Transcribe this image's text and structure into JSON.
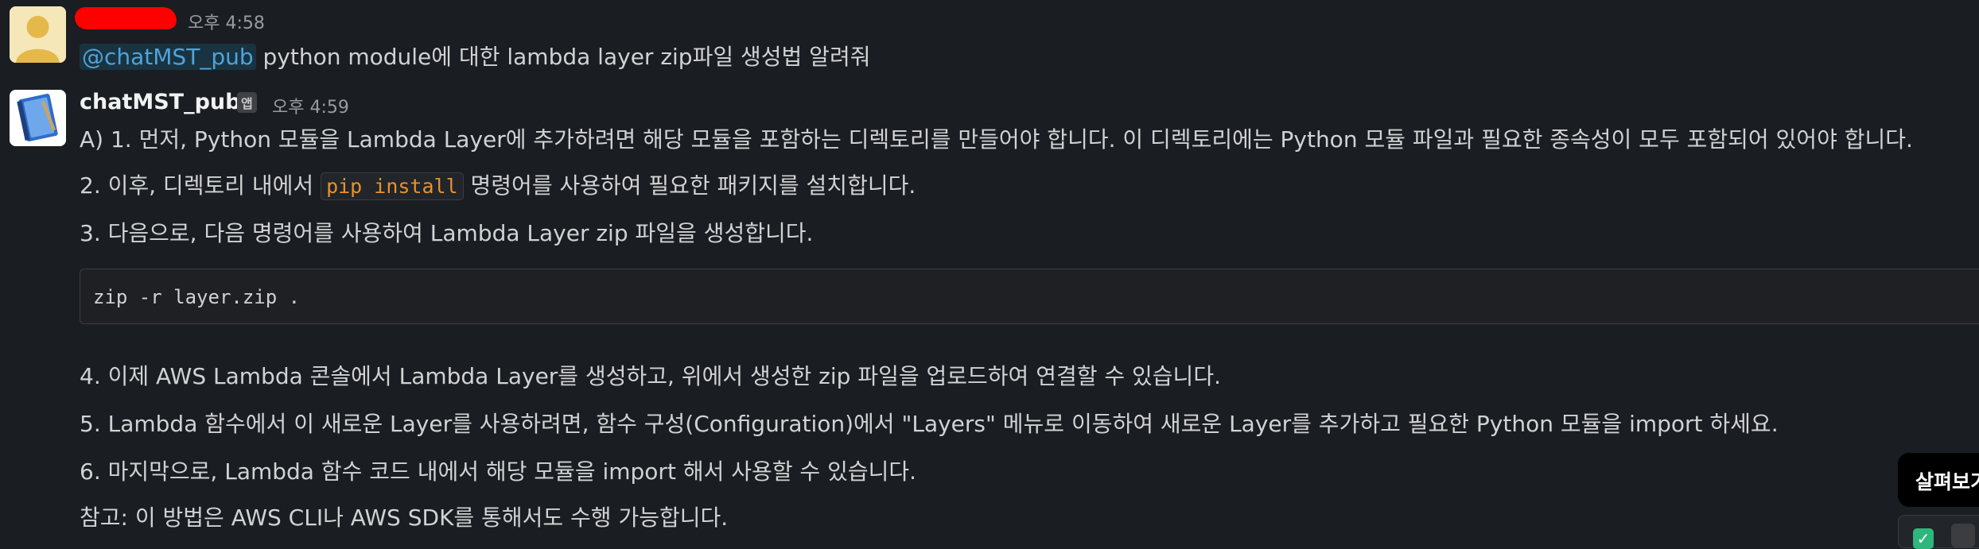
{
  "messages": [
    {
      "user": "",
      "time": "오후 4:58",
      "mention": "@chatMST_pub",
      "text": " python module에 대한 lambda layer zip파일 생성법 알려줘"
    },
    {
      "user": "chatMST_pub",
      "badge": "앱",
      "time": "오후 4:59",
      "lines": {
        "l1": "A) 1. 먼저, Python 모듈을 Lambda Layer에 추가하려면 해당 모듈을 포함하는 디렉토리를 만들어야 합니다. 이 디렉토리에는 Python 모듈 파일과 필요한 종속성이 모두 포함되어 있어야 합니다.",
        "l2_pre": "2. 이후, 디렉토리 내에서 ",
        "l2_code": "pip install",
        "l2_post": " 명령어를 사용하여 필요한 패키지를 설치합니다.",
        "l3": "3. 다음으로, 다음 명령어를 사용하여 Lambda Layer zip 파일을 생성합니다.",
        "code": "zip -r layer.zip .",
        "l4": "4. 이제 AWS Lambda 콘솔에서 Lambda Layer를 생성하고, 위에서 생성한 zip 파일을 업로드하여 연결할 수 있습니다.",
        "l5": "5. Lambda 함수에서 이 새로운 Layer를 사용하려면, 함수 구성(Configuration)에서 \"Layers\" 메뉴로 이동하여 새로운 Layer를 추가하고 필요한 Python 모듈을 import 하세요.",
        "l6": "6. 마지막으로, Lambda 함수 코드 내에서 해당 모듈을 import 해서 사용할 수 있습니다.",
        "note": "참고: 이 방법은 AWS CLI나 AWS SDK를 통해서도 수행 가능합니다."
      }
    }
  ],
  "tooltip": "살펴보기",
  "colors": {
    "background": "#1a1d21",
    "mention": "#4fa3d9",
    "inline_code": "#e8912d",
    "check": "#2eb67d"
  },
  "icons": {
    "user_avatar": "user-avatar-icon",
    "bot_avatar": "notebook-avatar-icon",
    "check": "checkmark-icon"
  }
}
